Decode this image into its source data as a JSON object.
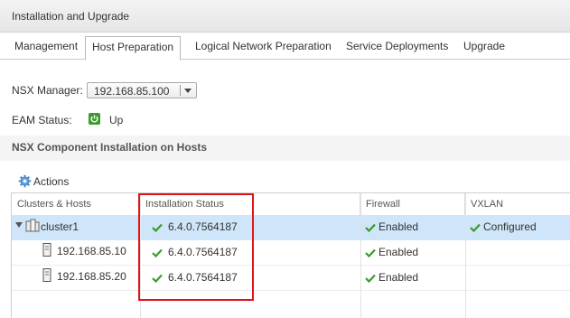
{
  "window": {
    "title": "Installation and Upgrade"
  },
  "tabs": [
    {
      "label": "Management"
    },
    {
      "label": "Host Preparation"
    },
    {
      "label": "Logical Network Preparation"
    },
    {
      "label": "Service Deployments"
    },
    {
      "label": "Upgrade"
    }
  ],
  "nsx_manager": {
    "label": "NSX Manager:",
    "value": "192.168.85.100"
  },
  "eam": {
    "label": "EAM Status:",
    "value": "Up",
    "icon": "power-icon",
    "color": "#3a9b2c"
  },
  "section": {
    "title": "NSX Component Installation on Hosts"
  },
  "toolbar": {
    "actions_label": "Actions",
    "icon": "gear-icon"
  },
  "table": {
    "columns": [
      "Clusters & Hosts",
      "Installation Status",
      "Firewall",
      "VXLAN"
    ],
    "rows": [
      {
        "name": "cluster1",
        "installation_status": "6.4.0.7564187",
        "firewall": "Enabled",
        "vxlan": "Configured",
        "icon": "cluster-icon"
      },
      {
        "name": "192.168.85.10",
        "installation_status": "6.4.0.7564187",
        "firewall": "Enabled",
        "vxlan": "",
        "icon": "host-icon"
      },
      {
        "name": "192.168.85.20",
        "installation_status": "6.4.0.7564187",
        "firewall": "Enabled",
        "vxlan": "",
        "icon": "host-icon"
      }
    ]
  },
  "colors": {
    "selected_row": "#cfe5f9",
    "highlight_border": "#e0151b",
    "check": "#3a9b2c"
  }
}
